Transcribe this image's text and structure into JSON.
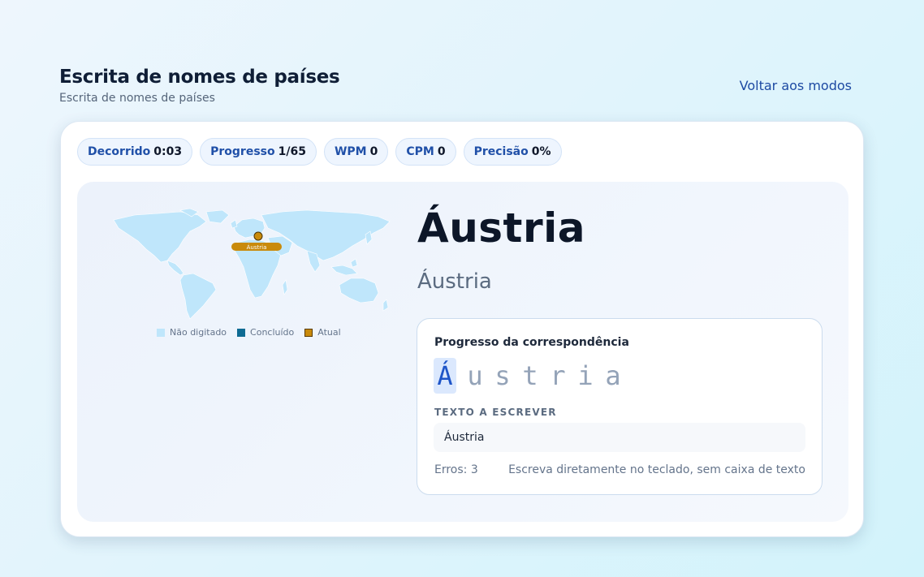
{
  "header": {
    "title": "Escrita de nomes de países",
    "subtitle": "Escrita de nomes de países",
    "back_label": "Voltar aos modos"
  },
  "stats": [
    {
      "label": "Decorrido",
      "value": "0:03"
    },
    {
      "label": "Progresso",
      "value": "1/65"
    },
    {
      "label": "WPM",
      "value": "0"
    },
    {
      "label": "CPM",
      "value": "0"
    },
    {
      "label": "Precisão",
      "value": "0%"
    }
  ],
  "map": {
    "current_label": "Áustria",
    "legend": {
      "todo": "Não digitado",
      "done": "Concluído",
      "current": "Atual"
    },
    "colors": {
      "todo": "#bfe6fb",
      "done": "#0e6b93",
      "current": "#c98a0a"
    }
  },
  "country": {
    "name": "Áustria",
    "localized": "Áustria"
  },
  "match": {
    "title": "Progresso da correspondência",
    "letters": [
      "Á",
      "u",
      "s",
      "t",
      "r",
      "i",
      "a"
    ],
    "current_index": 0,
    "type_label": "TEXTO A ESCREVER",
    "text_to_type": "Áustria",
    "errors": "Erros: 3",
    "hint": "Escreva diretamente no teclado, sem caixa de texto"
  }
}
